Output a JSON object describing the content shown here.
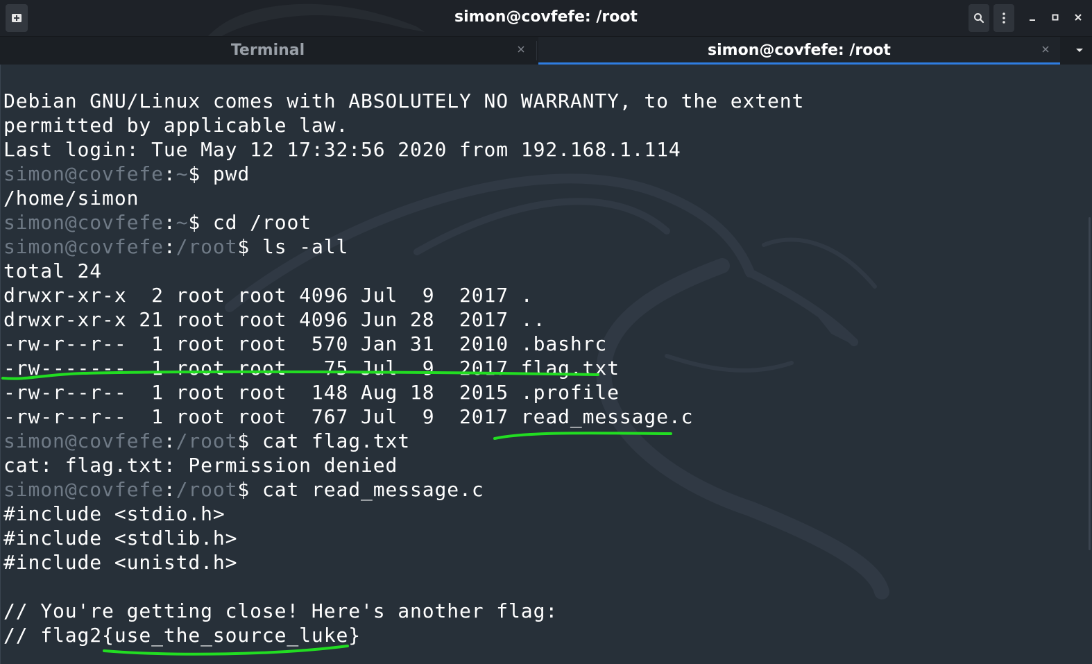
{
  "window": {
    "title": "simon@covfefe: /root"
  },
  "tabs": [
    {
      "label": "Terminal",
      "active": false
    },
    {
      "label": "simon@covfefe: /root",
      "active": true
    }
  ],
  "colors": {
    "accent": "#2f7de1",
    "annotation": "#22dd22",
    "prompt": "#6f7a86",
    "text": "#ffffff",
    "background": "#273039"
  },
  "icons": {
    "new_tab": "new-tab-icon",
    "search": "search-icon",
    "menu": "kebab-menu-icon",
    "minimize": "minimize-icon",
    "maximize": "maximize-icon",
    "close": "close-icon",
    "tab_close": "close-icon",
    "tabs_dropdown": "chevron-down-icon"
  },
  "terminal": {
    "lines": [
      {
        "type": "out",
        "text": "Debian GNU/Linux comes with ABSOLUTELY NO WARRANTY, to the extent"
      },
      {
        "type": "out",
        "text": "permitted by applicable law."
      },
      {
        "type": "out",
        "text": "Last login: Tue May 12 17:32:56 2020 from 192.168.1.114"
      },
      {
        "type": "cmd",
        "user": "simon@covfefe",
        "dir": "~",
        "cmd": "pwd"
      },
      {
        "type": "out",
        "text": "/home/simon"
      },
      {
        "type": "cmd",
        "user": "simon@covfefe",
        "dir": "~",
        "cmd": "cd /root"
      },
      {
        "type": "cmd",
        "user": "simon@covfefe",
        "dir": "/root",
        "cmd": "ls -all"
      },
      {
        "type": "out",
        "text": "total 24"
      },
      {
        "type": "out",
        "text": "drwxr-xr-x  2 root root 4096 Jul  9  2017 ."
      },
      {
        "type": "out",
        "text": "drwxr-xr-x 21 root root 4096 Jun 28  2017 .."
      },
      {
        "type": "out",
        "text": "-rw-r--r--  1 root root  570 Jan 31  2010 .bashrc"
      },
      {
        "type": "out",
        "text": "-rw-------  1 root root   75 Jul  9  2017 flag.txt"
      },
      {
        "type": "out",
        "text": "-rw-r--r--  1 root root  148 Aug 18  2015 .profile"
      },
      {
        "type": "out",
        "text": "-rw-r--r--  1 root root  767 Jul  9  2017 read_message.c"
      },
      {
        "type": "cmd",
        "user": "simon@covfefe",
        "dir": "/root",
        "cmd": "cat flag.txt"
      },
      {
        "type": "out",
        "text": "cat: flag.txt: Permission denied"
      },
      {
        "type": "cmd",
        "user": "simon@covfefe",
        "dir": "/root",
        "cmd": "cat read_message.c"
      },
      {
        "type": "out",
        "text": "#include <stdio.h>"
      },
      {
        "type": "out",
        "text": "#include <stdlib.h>"
      },
      {
        "type": "out",
        "text": "#include <unistd.h>"
      },
      {
        "type": "out",
        "text": ""
      },
      {
        "type": "out",
        "text": "// You're getting close! Here's another flag:"
      },
      {
        "type": "out",
        "text": "// flag2{use_the_source_luke}"
      }
    ]
  }
}
